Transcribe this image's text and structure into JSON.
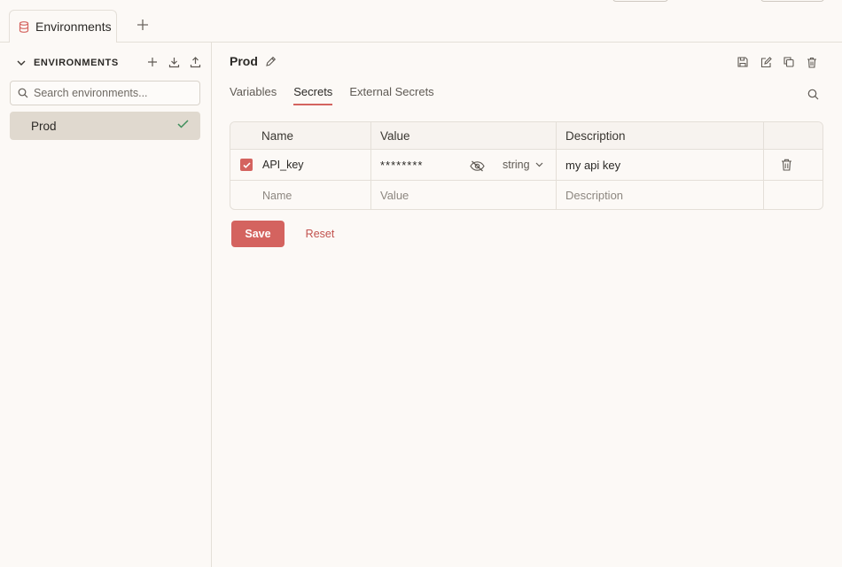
{
  "tabs": [
    {
      "label": "Environments",
      "icon": "database-icon",
      "active": true
    }
  ],
  "sidebar": {
    "title": "ENVIRONMENTS",
    "search_placeholder": "Search environments...",
    "items": [
      {
        "label": "Prod",
        "selected": true,
        "status_icon": "check-icon"
      }
    ]
  },
  "main": {
    "env_name": "Prod",
    "tabs": [
      {
        "label": "Variables",
        "active": false
      },
      {
        "label": "Secrets",
        "active": true
      },
      {
        "label": "External Secrets",
        "active": false
      }
    ],
    "table": {
      "headers": [
        "Name",
        "Value",
        "Description"
      ],
      "rows": [
        {
          "enabled": true,
          "name": "API_key",
          "value": "********",
          "type": "string",
          "description": "my api key"
        }
      ],
      "new_row": {
        "name_placeholder": "Name",
        "value_placeholder": "Value",
        "description_placeholder": "Description"
      }
    },
    "save_label": "Save",
    "reset_label": "Reset"
  },
  "colors": {
    "accent": "#d4635f",
    "background": "#fcf9f6",
    "selected_item": "#e0d9cf",
    "border": "#e4dfd8",
    "success": "#3e8e5a"
  }
}
